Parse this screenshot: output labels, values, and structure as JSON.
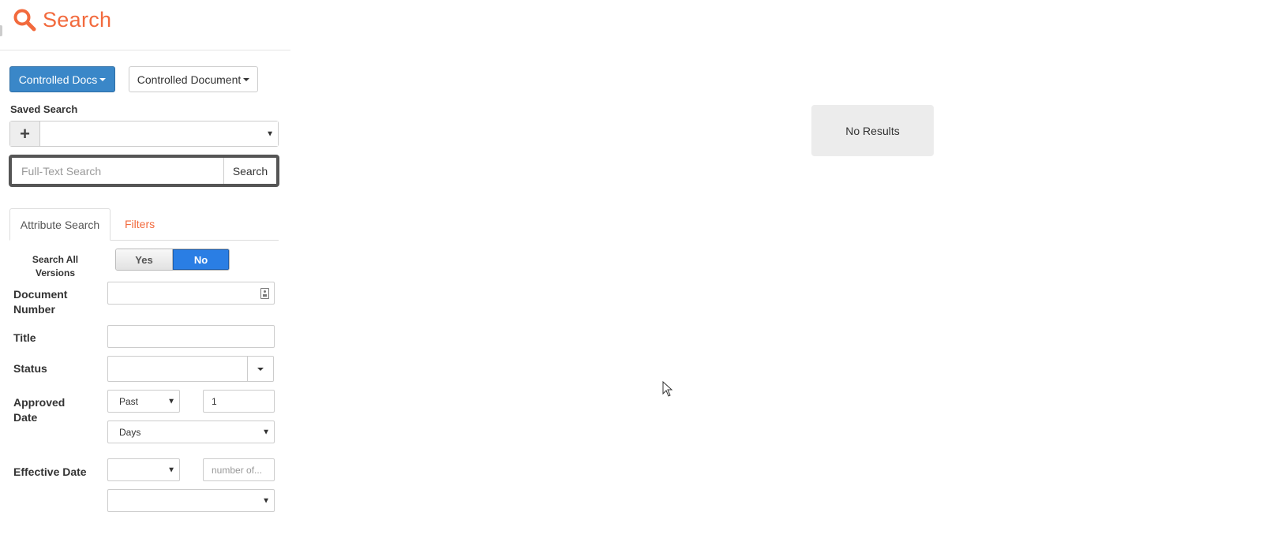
{
  "header": {
    "icon": "search-icon",
    "title": "Search",
    "accent_color": "#f26a3d"
  },
  "toolbar": {
    "library_button": "Controlled Docs",
    "doctype_button": "Controlled Document"
  },
  "saved_search": {
    "label": "Saved Search",
    "add_icon": "plus-icon",
    "add_glyph": "+",
    "selected": ""
  },
  "fulltext": {
    "placeholder": "Full-Text Search",
    "value": "",
    "button": "Search"
  },
  "tabs": [
    {
      "label": "Attribute Search",
      "active": true
    },
    {
      "label": "Filters",
      "active": false
    }
  ],
  "form": {
    "search_all_versions": {
      "label": "Search All Versions",
      "yes": "Yes",
      "no": "No",
      "selected": "No"
    },
    "document_number": {
      "label": "Document Number",
      "value": ""
    },
    "title": {
      "label": "Title",
      "value": ""
    },
    "status": {
      "label": "Status",
      "value": ""
    },
    "approved_date": {
      "label": "Approved Date",
      "direction": "Past",
      "amount": "1",
      "unit": "Days"
    },
    "effective_date": {
      "label": "Effective Date",
      "direction": "",
      "amount_placeholder": "number of...",
      "unit": ""
    }
  },
  "results": {
    "message": "No Results"
  },
  "colors": {
    "primary_button": "#3a87c8",
    "toggle_active": "#2a7ee4"
  }
}
